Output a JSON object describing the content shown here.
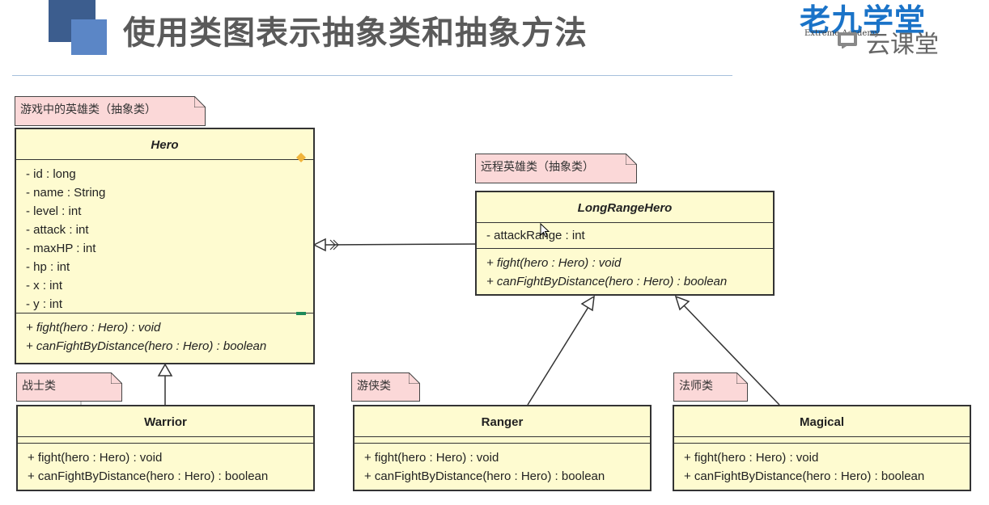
{
  "slide": {
    "title": "使用类图表示抽象类和抽象方法"
  },
  "brand": {
    "name": "老九学堂",
    "tagline": "Extreme Academy",
    "cloud_label": "云课堂"
  },
  "notes": {
    "hero": "游戏中的英雄类（抽象类）",
    "long_range": "远程英雄类（抽象类）",
    "warrior": "战士类",
    "ranger": "游侠类",
    "magical": "法师类"
  },
  "classes": {
    "hero": {
      "name": "Hero",
      "attributes": [
        "- id : long",
        "- name : String",
        "- level : int",
        "- attack : int",
        "- maxHP : int",
        "- hp : int",
        "- x : int",
        "- y : int"
      ],
      "operations": [
        "+ fight(hero : Hero) : void",
        "+ canFightByDistance(hero : Hero) : boolean"
      ]
    },
    "long_range_hero": {
      "name": "LongRangeHero",
      "attributes": [
        "- attackRange : int"
      ],
      "operations": [
        "+ fight(hero : Hero) : void",
        "+ canFightByDistance(hero : Hero) : boolean"
      ]
    },
    "warrior": {
      "name": "Warrior",
      "operations": [
        "+ fight(hero : Hero) : void",
        "+ canFightByDistance(hero : Hero) : boolean"
      ]
    },
    "ranger": {
      "name": "Ranger",
      "operations": [
        "+ fight(hero : Hero) : void",
        "+ canFightByDistance(hero : Hero) : boolean"
      ]
    },
    "magical": {
      "name": "Magical",
      "operations": [
        "+ fight(hero : Hero) : void",
        "+ canFightByDistance(hero : Hero) : boolean"
      ]
    }
  },
  "colors": {
    "class_fill": "#fefbd0",
    "note_fill": "#fbd8d8",
    "brand_blue": "#1a73c8",
    "deco_dark": "#3c5d8e",
    "deco_light": "#5b86c6"
  },
  "icons": [
    "cloud-icon",
    "cursor-icon",
    "fold-corner-icon"
  ]
}
